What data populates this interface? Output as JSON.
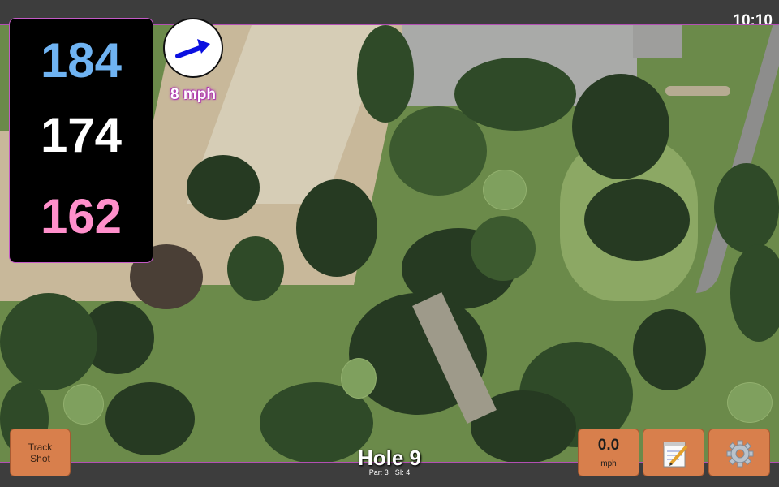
{
  "status": {
    "time": "10:10"
  },
  "distances": {
    "back": "184",
    "middle": "174",
    "front": "162"
  },
  "wind": {
    "speed_label": "8 mph",
    "icon": "arrow-right-icon"
  },
  "buttons": {
    "track_shot": "Track\nShot",
    "speed_value": "0.0",
    "speed_unit": "mph",
    "notes_icon": "notepad-icon",
    "settings_icon": "gear-icon"
  },
  "hole": {
    "title": "Hole 9",
    "par": "Par: 3",
    "si": "SI: 4"
  },
  "colors": {
    "back": "#6fb3f2",
    "middle": "#ffffff",
    "front": "#ff8fcb",
    "button": "#d87f4c",
    "accent": "#b24fb4"
  }
}
